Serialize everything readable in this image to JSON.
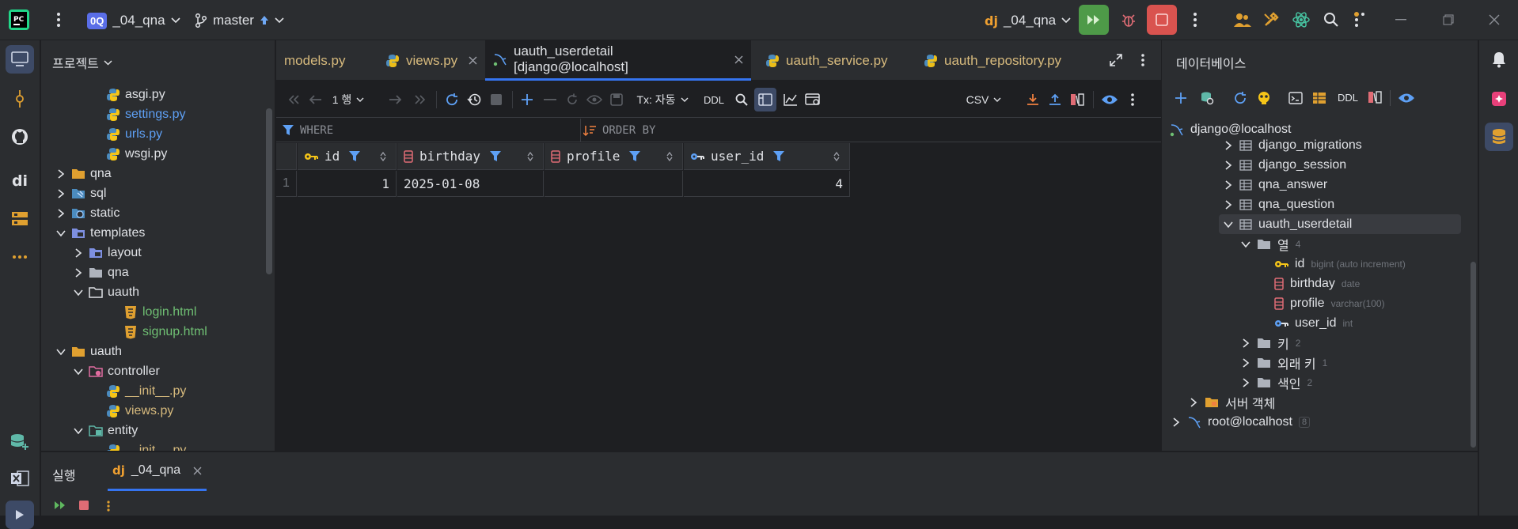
{
  "titlebar": {
    "project_badge": "0Q",
    "project_name": "_04_qna",
    "branch": "master",
    "run_config": "_04_qna"
  },
  "project_panel": {
    "title": "프로젝트",
    "tree": [
      {
        "label": "asgi.py",
        "kind": "py",
        "color": "#dfe1e5",
        "depth": 3,
        "chevron": ""
      },
      {
        "label": "settings.py",
        "kind": "py",
        "color": "#5ea0f5",
        "depth": 3,
        "chevron": ""
      },
      {
        "label": "urls.py",
        "kind": "py",
        "color": "#5ea0f5",
        "depth": 3,
        "chevron": ""
      },
      {
        "label": "wsgi.py",
        "kind": "py",
        "color": "#dfe1e5",
        "depth": 3,
        "chevron": ""
      },
      {
        "label": "qna",
        "kind": "folder",
        "color": "#dfe1e5",
        "depth": 1,
        "chevron": "right"
      },
      {
        "label": "sql",
        "kind": "folder-sql",
        "color": "#dfe1e5",
        "depth": 1,
        "chevron": "right"
      },
      {
        "label": "static",
        "kind": "folder-web",
        "color": "#dfe1e5",
        "depth": 1,
        "chevron": "right"
      },
      {
        "label": "templates",
        "kind": "folder-tpl",
        "color": "#dfe1e5",
        "depth": 1,
        "chevron": "down"
      },
      {
        "label": "layout",
        "kind": "folder-tpl",
        "color": "#dfe1e5",
        "depth": 2,
        "chevron": "right"
      },
      {
        "label": "qna",
        "kind": "folder-plain",
        "color": "#dfe1e5",
        "depth": 2,
        "chevron": "right"
      },
      {
        "label": "uauth",
        "kind": "folder-open",
        "color": "#dfe1e5",
        "depth": 2,
        "chevron": "down"
      },
      {
        "label": "login.html",
        "kind": "html",
        "color": "#6fbf73",
        "depth": 4,
        "chevron": ""
      },
      {
        "label": "signup.html",
        "kind": "html",
        "color": "#6fbf73",
        "depth": 4,
        "chevron": ""
      },
      {
        "label": "uauth",
        "kind": "folder",
        "color": "#dfe1e5",
        "depth": 1,
        "chevron": "down"
      },
      {
        "label": "controller",
        "kind": "folder-ctrl",
        "color": "#dfe1e5",
        "depth": 2,
        "chevron": "down"
      },
      {
        "label": "__init__.py",
        "kind": "py",
        "color": "#d7ba7d",
        "depth": 3,
        "chevron": ""
      },
      {
        "label": "views.py",
        "kind": "py",
        "color": "#d7ba7d",
        "depth": 3,
        "chevron": ""
      },
      {
        "label": "entity",
        "kind": "folder-ent",
        "color": "#dfe1e5",
        "depth": 2,
        "chevron": "down"
      },
      {
        "label": "__init__.py",
        "kind": "py",
        "color": "#d7ba7d",
        "depth": 3,
        "chevron": ""
      }
    ]
  },
  "tabs": [
    {
      "label": "models.py",
      "icon": "none",
      "active": false,
      "close": false
    },
    {
      "label": "views.py",
      "icon": "python",
      "active": false,
      "close": true
    },
    {
      "label": "uauth_userdetail [django@localhost]",
      "icon": "mysql",
      "active": true,
      "close": true
    },
    {
      "label": "uauth_service.py",
      "icon": "python",
      "active": false,
      "close": false
    },
    {
      "label": "uauth_repository.py",
      "icon": "python",
      "active": false,
      "close": false
    }
  ],
  "db_toolbar": {
    "row_count": "1 행",
    "tx_mode": "Tx: 자동",
    "ddl_label": "DDL",
    "export_format": "CSV"
  },
  "filter_bar": {
    "where_label": "WHERE",
    "order_label": "ORDER BY"
  },
  "grid": {
    "columns": [
      {
        "name": "id",
        "icon": "key"
      },
      {
        "name": "birthday",
        "icon": "col"
      },
      {
        "name": "profile",
        "icon": "col"
      },
      {
        "name": "user_id",
        "icon": "fk"
      }
    ],
    "rows": [
      {
        "num": "1",
        "cells": [
          "1",
          "2025-01-08",
          "",
          "4"
        ]
      }
    ]
  },
  "db_panel": {
    "title": "데이터베이스",
    "ddl_label": "DDL",
    "connection": "django@localhost",
    "tables": [
      "django_migrations",
      "django_session",
      "qna_answer",
      "qna_question"
    ],
    "selected_table": "uauth_userdetail",
    "columns_folder": {
      "label": "열",
      "count": "4"
    },
    "columns": [
      {
        "name": "id",
        "type": "bigint (auto increment)",
        "icon": "key"
      },
      {
        "name": "birthday",
        "type": "date",
        "icon": "col"
      },
      {
        "name": "profile",
        "type": "varchar(100)",
        "icon": "col"
      },
      {
        "name": "user_id",
        "type": "int",
        "icon": "fk"
      }
    ],
    "folders": [
      {
        "label": "키",
        "count": "2"
      },
      {
        "label": "외래 키",
        "count": "1"
      },
      {
        "label": "색인",
        "count": "2"
      }
    ],
    "server_objects": "서버 객체",
    "root_connection": "root@localhost",
    "root_count": "8"
  },
  "run_panel": {
    "title": "실행",
    "tab_label": "_04_qna"
  },
  "colors": {
    "accent": "#3574f0",
    "run_green": "#4e9a48",
    "stop_red": "#d9534f",
    "python_blue": "#4b8bbe",
    "python_yellow": "#f5c518"
  }
}
